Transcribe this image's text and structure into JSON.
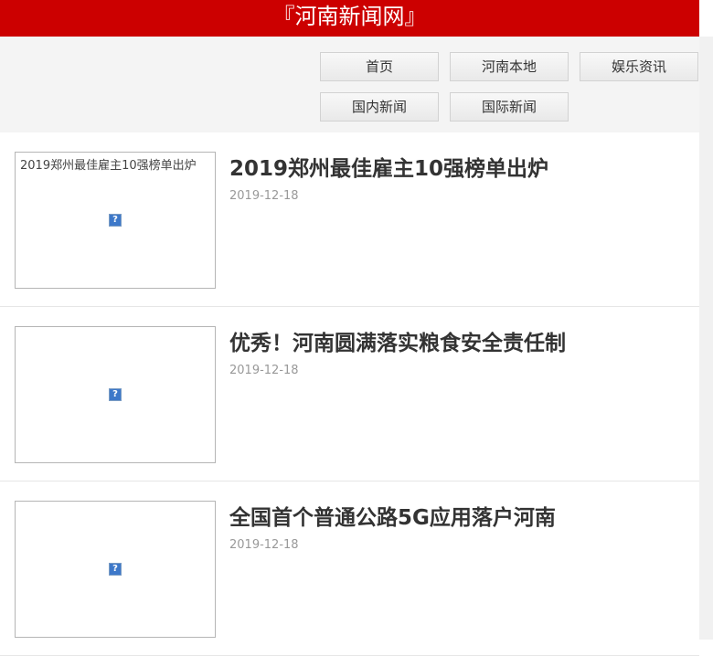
{
  "header": {
    "title": "『河南新闻网』"
  },
  "nav": {
    "items": [
      {
        "label": "首页"
      },
      {
        "label": "河南本地"
      },
      {
        "label": "娱乐资讯"
      },
      {
        "label": "国内新闻"
      },
      {
        "label": "国际新闻"
      }
    ]
  },
  "news": [
    {
      "title": "2019郑州最佳雇主10强榜单出炉",
      "date": "2019-12-18",
      "img_alt": "2019郑州最佳雇主10强榜单出炉"
    },
    {
      "title": "优秀！河南圆满落实粮食安全责任制",
      "date": "2019-12-18",
      "img_alt": ""
    },
    {
      "title": "全国首个普通公路5G应用落户河南",
      "date": "2019-12-18",
      "img_alt": ""
    }
  ],
  "icons": {
    "broken_image": "broken-image-icon"
  },
  "colors": {
    "brand": "#cc0000"
  }
}
